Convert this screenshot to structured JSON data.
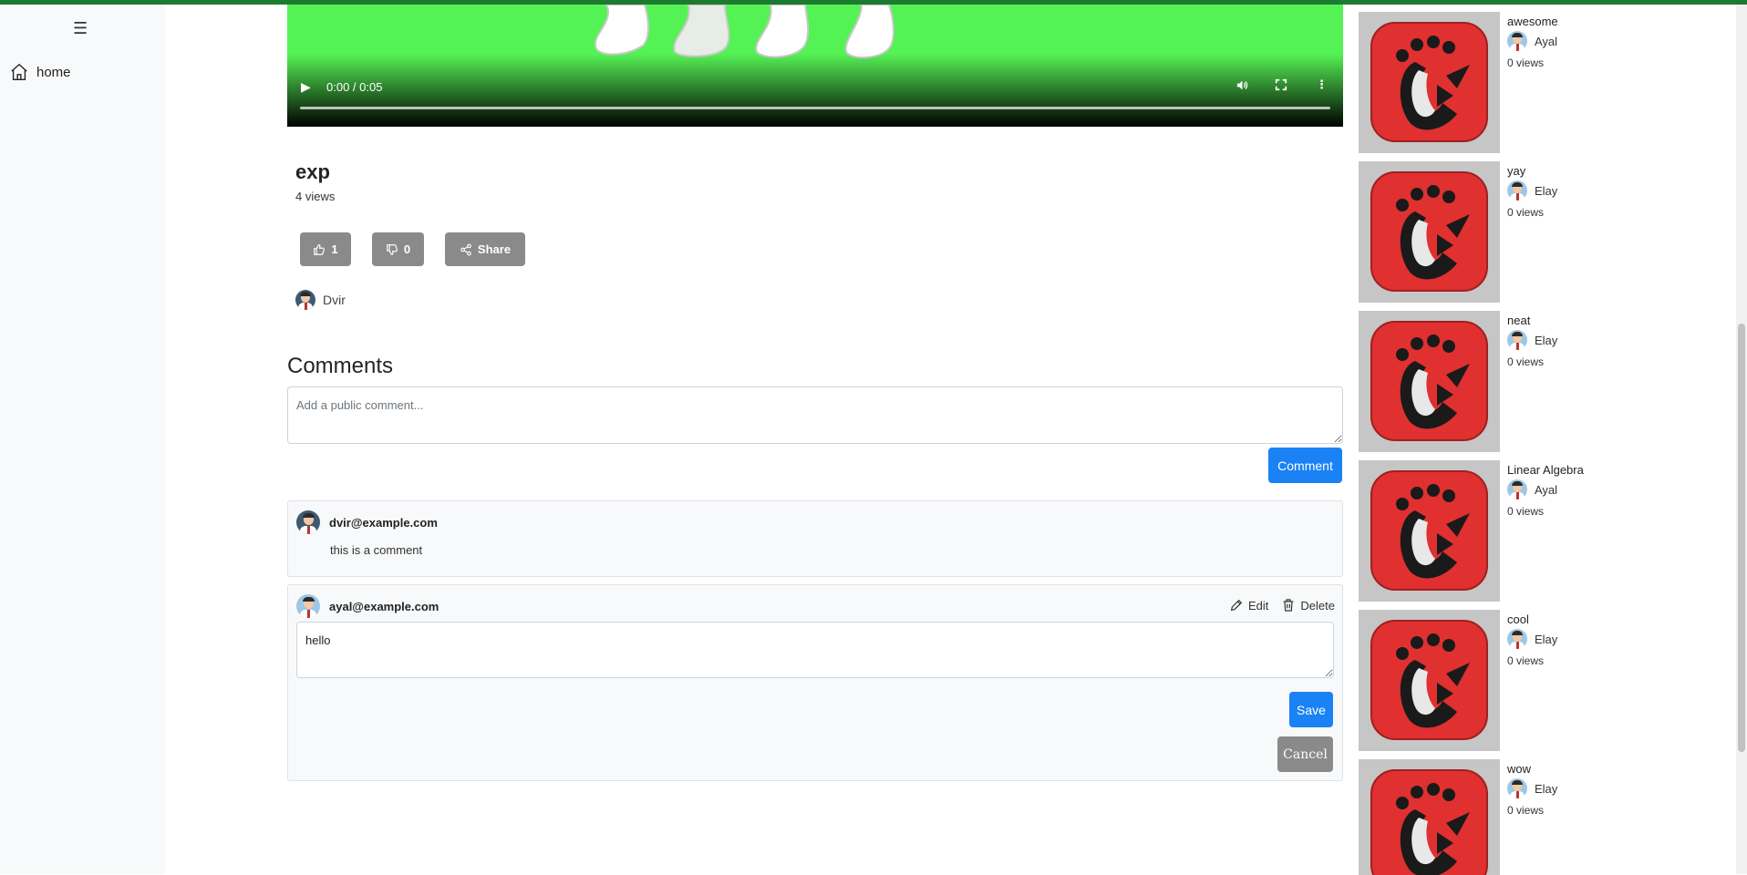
{
  "sidebar": {
    "menu_icon": "☰",
    "home_label": "home"
  },
  "video": {
    "time": "0:00 / 0:05",
    "title": "exp",
    "views": "4 views",
    "likes": "1",
    "dislikes": "0",
    "share_label": "Share",
    "owner": "Dvir"
  },
  "comments": {
    "heading": "Comments",
    "placeholder": "Add a public comment...",
    "submit_label": "Comment",
    "items": [
      {
        "author": "dvir@example.com",
        "text": "this is a comment"
      },
      {
        "author": "ayal@example.com",
        "text": "hello",
        "edit_label": "Edit",
        "delete_label": "Delete",
        "save_label": "Save",
        "cancel_label": "Cancel"
      }
    ]
  },
  "related": [
    {
      "title": "awesome",
      "channel": "Ayal",
      "views": "0 views"
    },
    {
      "title": "yay",
      "channel": "Elay",
      "views": "0 views"
    },
    {
      "title": "neat",
      "channel": "Elay",
      "views": "0 views"
    },
    {
      "title": "Linear Algebra",
      "channel": "Ayal",
      "views": "0 views"
    },
    {
      "title": "cool",
      "channel": "Elay",
      "views": "0 views"
    },
    {
      "title": "wow",
      "channel": "Elay",
      "views": "0 views"
    }
  ],
  "colors": {
    "primary": "#1a82f5",
    "secondary": "#8a8a8a",
    "video_bg": "#55f255",
    "thumb_red": "#e03030"
  }
}
